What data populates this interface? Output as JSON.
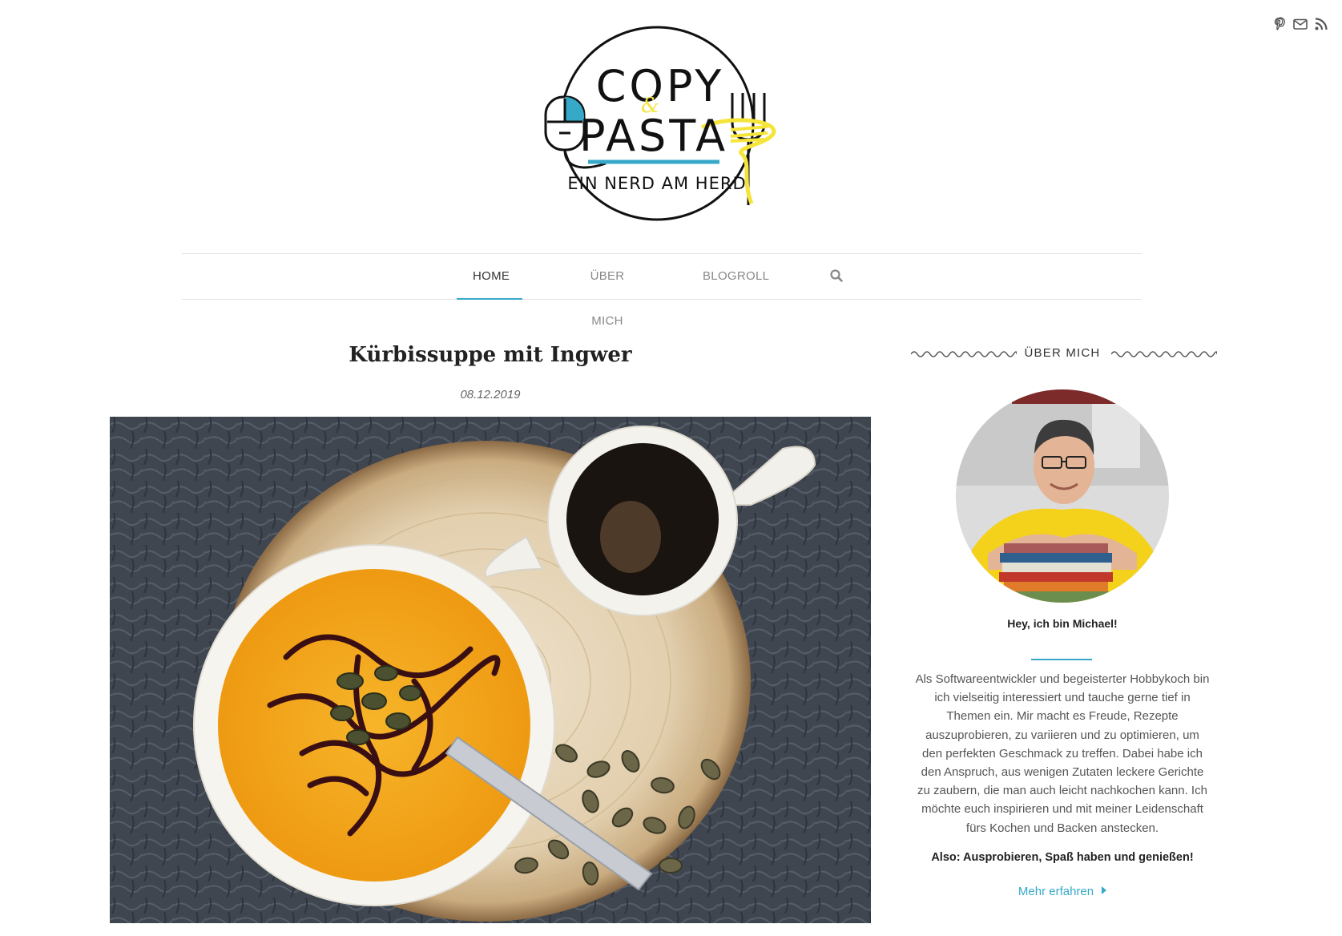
{
  "social": {
    "icons": [
      "pinterest-icon",
      "mail-icon",
      "rss-icon"
    ]
  },
  "logo": {
    "line1": "COPY",
    "amp": "&",
    "line2": "PASTA",
    "tagline": "EIN NERD AM HERD"
  },
  "nav": {
    "items": [
      {
        "label": "HOME",
        "active": true
      },
      {
        "label": "ÜBER MICH",
        "active": false
      },
      {
        "label": "BLOGROLL",
        "active": false
      }
    ],
    "search_icon": "search-icon"
  },
  "post": {
    "title": "Kürbissuppe mit Ingwer",
    "date": "08.12.2019"
  },
  "sidebar": {
    "title": "ÜBER MICH",
    "greeting": "Hey, ich bin Michael!",
    "about": "Als Softwareentwickler und begeisterter Hobbykoch bin ich vielseitig interessiert und tauche gerne tief in Themen ein. Mir macht es Freude, Rezepte auszuprobieren, zu variieren und zu optimieren, um den perfekten Geschmack zu treffen. Dabei habe ich den Anspruch, aus wenigen Zutaten leckere Gerichte zu zaubern, die man auch leicht nachkochen kann. Ich möchte euch inspirieren und mit meiner Leidenschaft fürs Kochen und Backen anstecken.",
    "motto": "Also: Ausprobieren, Spaß haben und genießen!",
    "more_link": "Mehr erfahren"
  },
  "colors": {
    "accent": "#36a9c9",
    "logo_yellow": "#f5e53a",
    "soup": "#f2a31c"
  }
}
